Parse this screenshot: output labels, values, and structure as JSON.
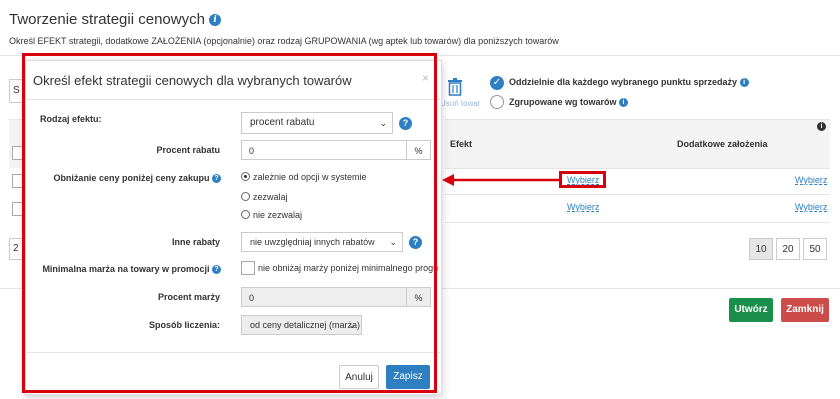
{
  "page": {
    "title": "Tworzenie strategii cenowych",
    "subtitle": "Określ EFEKT strategii, dodatkowe ZAŁOŻENIA (opcjonalnie) oraz rodzaj GRUPOWANIA (wg aptek lub towarów) dla poniższych towarów",
    "remove_label": "Usuń towar",
    "grouping_option_1": "Oddzielnie dla każdego wybranego punktu sprzedaży",
    "grouping_option_2": "Zgrupowane wg towarów",
    "col_effect": "Efekt",
    "col_assumptions": "Dodatkowe założenia",
    "row1_effect_link": "Wybierz",
    "row1_assumptions_link": "Wybierz",
    "row2_effect_link": "Wybierz",
    "row2_assumptions_link": "Wybierz",
    "page_sizes": [
      "10",
      "20",
      "50"
    ],
    "create_button": "Utwórz",
    "close_button": "Zamknij",
    "colors": {
      "accent": "#2e7fc2",
      "success": "#1a8f4c",
      "danger": "#cc4b4b",
      "highlight": "#d9000d"
    }
  },
  "modal": {
    "title": "Określ efekt strategii cenowych dla wybranych towarów",
    "close_icon": "×",
    "effect_type_label": "Rodzaj efektu:",
    "effect_type_value": "procent rabatu",
    "discount_percent_label": "Procent rabatu",
    "discount_percent_value": "0",
    "percent_sign": "%",
    "below_purchase_label": "Obniżanie ceny poniżej ceny zakupu",
    "below_purchase_options": [
      "zależnie od opcji w systemie",
      "zezwalaj",
      "nie zezwalaj"
    ],
    "below_purchase_selected": 0,
    "other_discounts_label": "Inne rabaty",
    "other_discounts_value": "nie uwzględniaj innych rabatów",
    "min_margin_label": "Minimalna marża na towary w promocji",
    "min_margin_checkbox_label": "nie obniżaj marży poniżej minimalnego progu",
    "margin_percent_label": "Procent marży",
    "margin_percent_value": "0",
    "calc_method_label": "Sposób liczenia:",
    "calc_method_value": "od ceny detalicznej (marża)",
    "cancel_button": "Anuluj",
    "save_button": "Zapisz"
  }
}
